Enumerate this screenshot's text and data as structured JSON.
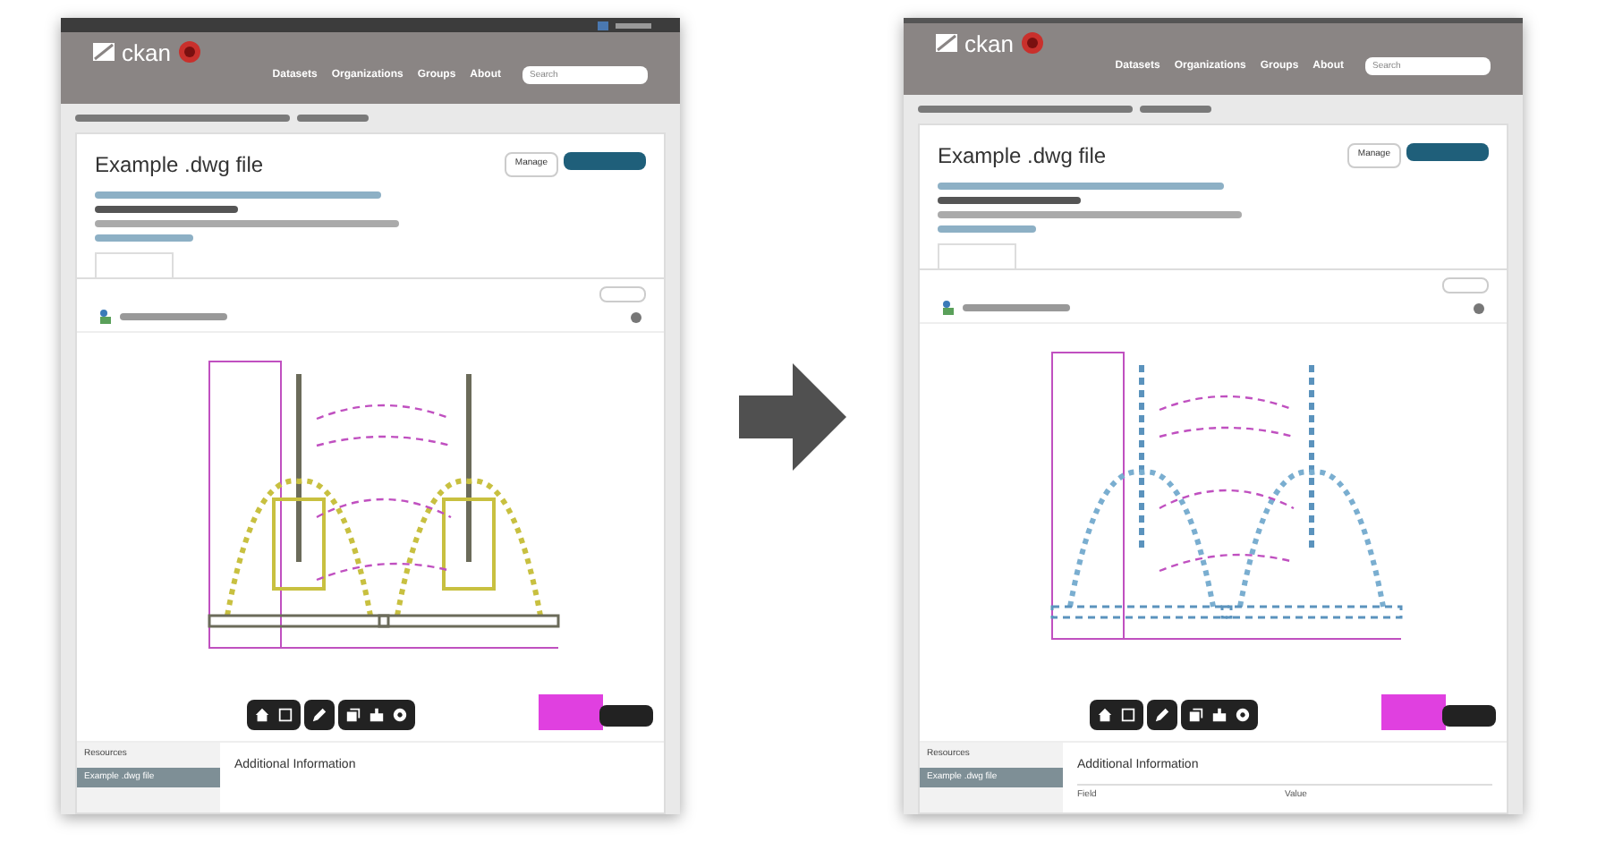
{
  "panels": [
    {
      "kind": "before",
      "top_bar": true,
      "logo": "ckan",
      "nav": [
        "Datasets",
        "Organizations",
        "Groups",
        "About"
      ],
      "search_placeholder": "Search",
      "title": "Example .dwg file",
      "manage": "Manage",
      "resources_label": "Resources",
      "resource_item": "Example .dwg file",
      "info_title": "Additional Information"
    },
    {
      "kind": "after",
      "top_bar": false,
      "logo": "ckan",
      "nav": [
        "Datasets",
        "Organizations",
        "Groups",
        "About"
      ],
      "search_placeholder": "Search",
      "title": "Example .dwg file",
      "manage": "Manage",
      "resources_label": "Resources",
      "resource_item": "Example .dwg file",
      "info_title": "Additional Information",
      "info_columns": [
        "Field",
        "Value"
      ]
    }
  ]
}
